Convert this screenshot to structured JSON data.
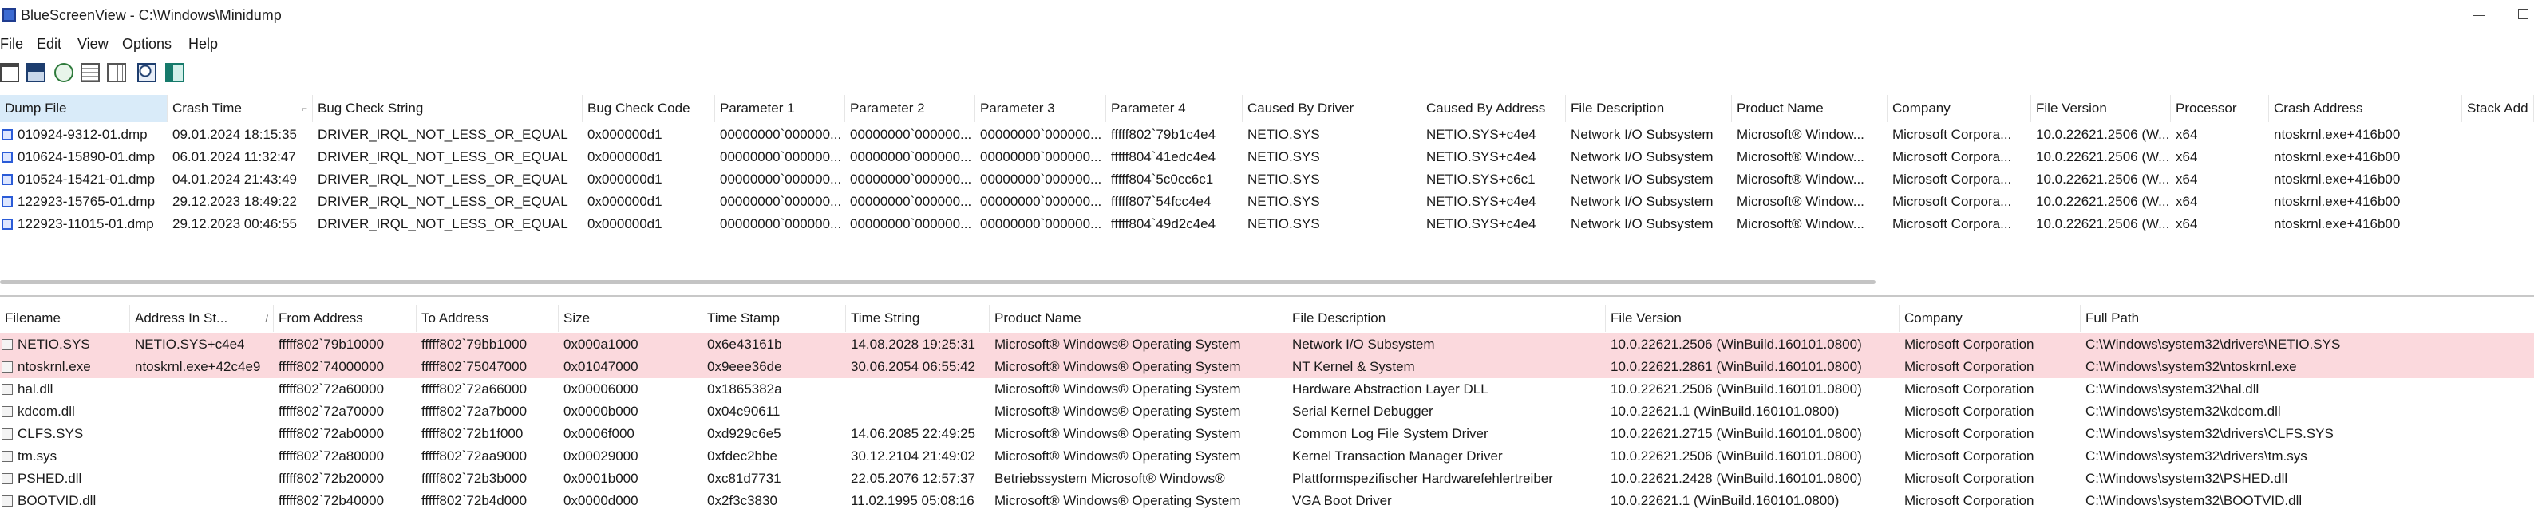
{
  "window": {
    "title": "BlueScreenView - C:\\Windows\\Minidump"
  },
  "menu": [
    "File",
    "Edit",
    "View",
    "Options",
    "Help"
  ],
  "toolbar": {
    "tools": [
      "properties-icon",
      "save-icon",
      "refresh-icon",
      "copy-icon",
      "html-report-icon",
      "find-icon",
      "exit-icon"
    ]
  },
  "dumps": {
    "columns": [
      "Dump File",
      "Crash Time",
      "Bug Check String",
      "Bug Check Code",
      "Parameter 1",
      "Parameter 2",
      "Parameter 3",
      "Parameter 4",
      "Caused By Driver",
      "Caused By Address",
      "File Description",
      "Product Name",
      "Company",
      "File Version",
      "Processor",
      "Crash Address",
      "Stack Add"
    ],
    "sorted_column": "Crash Time",
    "rows": [
      [
        "010924-9312-01.dmp",
        "09.01.2024 18:15:35",
        "DRIVER_IRQL_NOT_LESS_OR_EQUAL",
        "0x000000d1",
        "00000000`000000...",
        "00000000`000000...",
        "00000000`000000...",
        "fffff802`79b1c4e4",
        "NETIO.SYS",
        "NETIO.SYS+c4e4",
        "Network I/O Subsystem",
        "Microsoft® Window...",
        "Microsoft Corpora...",
        "10.0.22621.2506 (W...",
        "x64",
        "ntoskrnl.exe+416b00",
        ""
      ],
      [
        "010624-15890-01.dmp",
        "06.01.2024 11:32:47",
        "DRIVER_IRQL_NOT_LESS_OR_EQUAL",
        "0x000000d1",
        "00000000`000000...",
        "00000000`000000...",
        "00000000`000000...",
        "fffff804`41edc4e4",
        "NETIO.SYS",
        "NETIO.SYS+c4e4",
        "Network I/O Subsystem",
        "Microsoft® Window...",
        "Microsoft Corpora...",
        "10.0.22621.2506 (W...",
        "x64",
        "ntoskrnl.exe+416b00",
        ""
      ],
      [
        "010524-15421-01.dmp",
        "04.01.2024 21:43:49",
        "DRIVER_IRQL_NOT_LESS_OR_EQUAL",
        "0x000000d1",
        "00000000`000000...",
        "00000000`000000...",
        "00000000`000000...",
        "fffff804`5c0cc6c1",
        "NETIO.SYS",
        "NETIO.SYS+c6c1",
        "Network I/O Subsystem",
        "Microsoft® Window...",
        "Microsoft Corpora...",
        "10.0.22621.2506 (W...",
        "x64",
        "ntoskrnl.exe+416b00",
        ""
      ],
      [
        "122923-15765-01.dmp",
        "29.12.2023 18:49:22",
        "DRIVER_IRQL_NOT_LESS_OR_EQUAL",
        "0x000000d1",
        "00000000`000000...",
        "00000000`000000...",
        "00000000`000000...",
        "fffff807`54fcc4e4",
        "NETIO.SYS",
        "NETIO.SYS+c4e4",
        "Network I/O Subsystem",
        "Microsoft® Window...",
        "Microsoft Corpora...",
        "10.0.22621.2506 (W...",
        "x64",
        "ntoskrnl.exe+416b00",
        ""
      ],
      [
        "122923-11015-01.dmp",
        "29.12.2023 00:46:55",
        "DRIVER_IRQL_NOT_LESS_OR_EQUAL",
        "0x000000d1",
        "00000000`000000...",
        "00000000`000000...",
        "00000000`000000...",
        "fffff804`49d2c4e4",
        "NETIO.SYS",
        "NETIO.SYS+c4e4",
        "Network I/O Subsystem",
        "Microsoft® Window...",
        "Microsoft Corpora...",
        "10.0.22621.2506 (W...",
        "x64",
        "ntoskrnl.exe+416b00",
        ""
      ]
    ]
  },
  "drivers": {
    "columns": [
      "Filename",
      "Address In St...",
      "From Address",
      "To Address",
      "Size",
      "Time Stamp",
      "Time String",
      "Product Name",
      "File Description",
      "File Version",
      "Company",
      "Full Path"
    ],
    "sort_indicator": "/",
    "rows": [
      [
        "NETIO.SYS",
        "NETIO.SYS+c4e4",
        "fffff802`79b10000",
        "fffff802`79bb1000",
        "0x000a1000",
        "0x6e43161b",
        "14.08.2028 19:25:31",
        "Microsoft® Windows® Operating System",
        "Network I/O Subsystem",
        "10.0.22621.2506 (WinBuild.160101.0800)",
        "Microsoft Corporation",
        "C:\\Windows\\system32\\drivers\\NETIO.SYS"
      ],
      [
        "ntoskrnl.exe",
        "ntoskrnl.exe+42c4e9",
        "fffff802`74000000",
        "fffff802`75047000",
        "0x01047000",
        "0x9eee36de",
        "30.06.2054 06:55:42",
        "Microsoft® Windows® Operating System",
        "NT Kernel & System",
        "10.0.22621.2861 (WinBuild.160101.0800)",
        "Microsoft Corporation",
        "C:\\Windows\\system32\\ntoskrnl.exe"
      ],
      [
        "hal.dll",
        "",
        "fffff802`72a60000",
        "fffff802`72a66000",
        "0x00006000",
        "0x1865382a",
        "",
        "Microsoft® Windows® Operating System",
        "Hardware Abstraction Layer DLL",
        "10.0.22621.2506 (WinBuild.160101.0800)",
        "Microsoft Corporation",
        "C:\\Windows\\system32\\hal.dll"
      ],
      [
        "kdcom.dll",
        "",
        "fffff802`72a70000",
        "fffff802`72a7b000",
        "0x0000b000",
        "0x04c90611",
        "",
        "Microsoft® Windows® Operating System",
        "Serial Kernel Debugger",
        "10.0.22621.1 (WinBuild.160101.0800)",
        "Microsoft Corporation",
        "C:\\Windows\\system32\\kdcom.dll"
      ],
      [
        "CLFS.SYS",
        "",
        "fffff802`72ab0000",
        "fffff802`72b1f000",
        "0x0006f000",
        "0xd929c6e5",
        "14.06.2085 22:49:25",
        "Microsoft® Windows® Operating System",
        "Common Log File System Driver",
        "10.0.22621.2715 (WinBuild.160101.0800)",
        "Microsoft Corporation",
        "C:\\Windows\\system32\\drivers\\CLFS.SYS"
      ],
      [
        "tm.sys",
        "",
        "fffff802`72a80000",
        "fffff802`72aa9000",
        "0x00029000",
        "0xfdec2bbe",
        "30.12.2104 21:49:02",
        "Microsoft® Windows® Operating System",
        "Kernel Transaction Manager Driver",
        "10.0.22621.2506 (WinBuild.160101.0800)",
        "Microsoft Corporation",
        "C:\\Windows\\system32\\drivers\\tm.sys"
      ],
      [
        "PSHED.dll",
        "",
        "fffff802`72b20000",
        "fffff802`72b3b000",
        "0x0001b000",
        "0xc81d7731",
        "22.05.2076 12:57:37",
        "Betriebssystem Microsoft® Windows®",
        "Plattformspezifischer Hardwarefehlertreiber",
        "10.0.22621.2428 (WinBuild.160101.0800)",
        "Microsoft Corporation",
        "C:\\Windows\\system32\\PSHED.dll"
      ],
      [
        "BOOTVID.dll",
        "",
        "fffff802`72b40000",
        "fffff802`72b4d000",
        "0x0000d000",
        "0x2f3c3830",
        "11.02.1995 05:08:16",
        "Microsoft® Windows® Operating System",
        "VGA Boot Driver",
        "10.0.22621.1 (WinBuild.160101.0800)",
        "Microsoft Corporation",
        "C:\\Windows\\system32\\BOOTVID.dll"
      ]
    ],
    "highlighted_rows": [
      0,
      1
    ],
    "highlight_color": "#fbd9dd"
  },
  "colors": {
    "sorted_header": "#d9ebf9",
    "row_highlight": "#fbd9dd",
    "app_icon": "#3c6bd2"
  }
}
